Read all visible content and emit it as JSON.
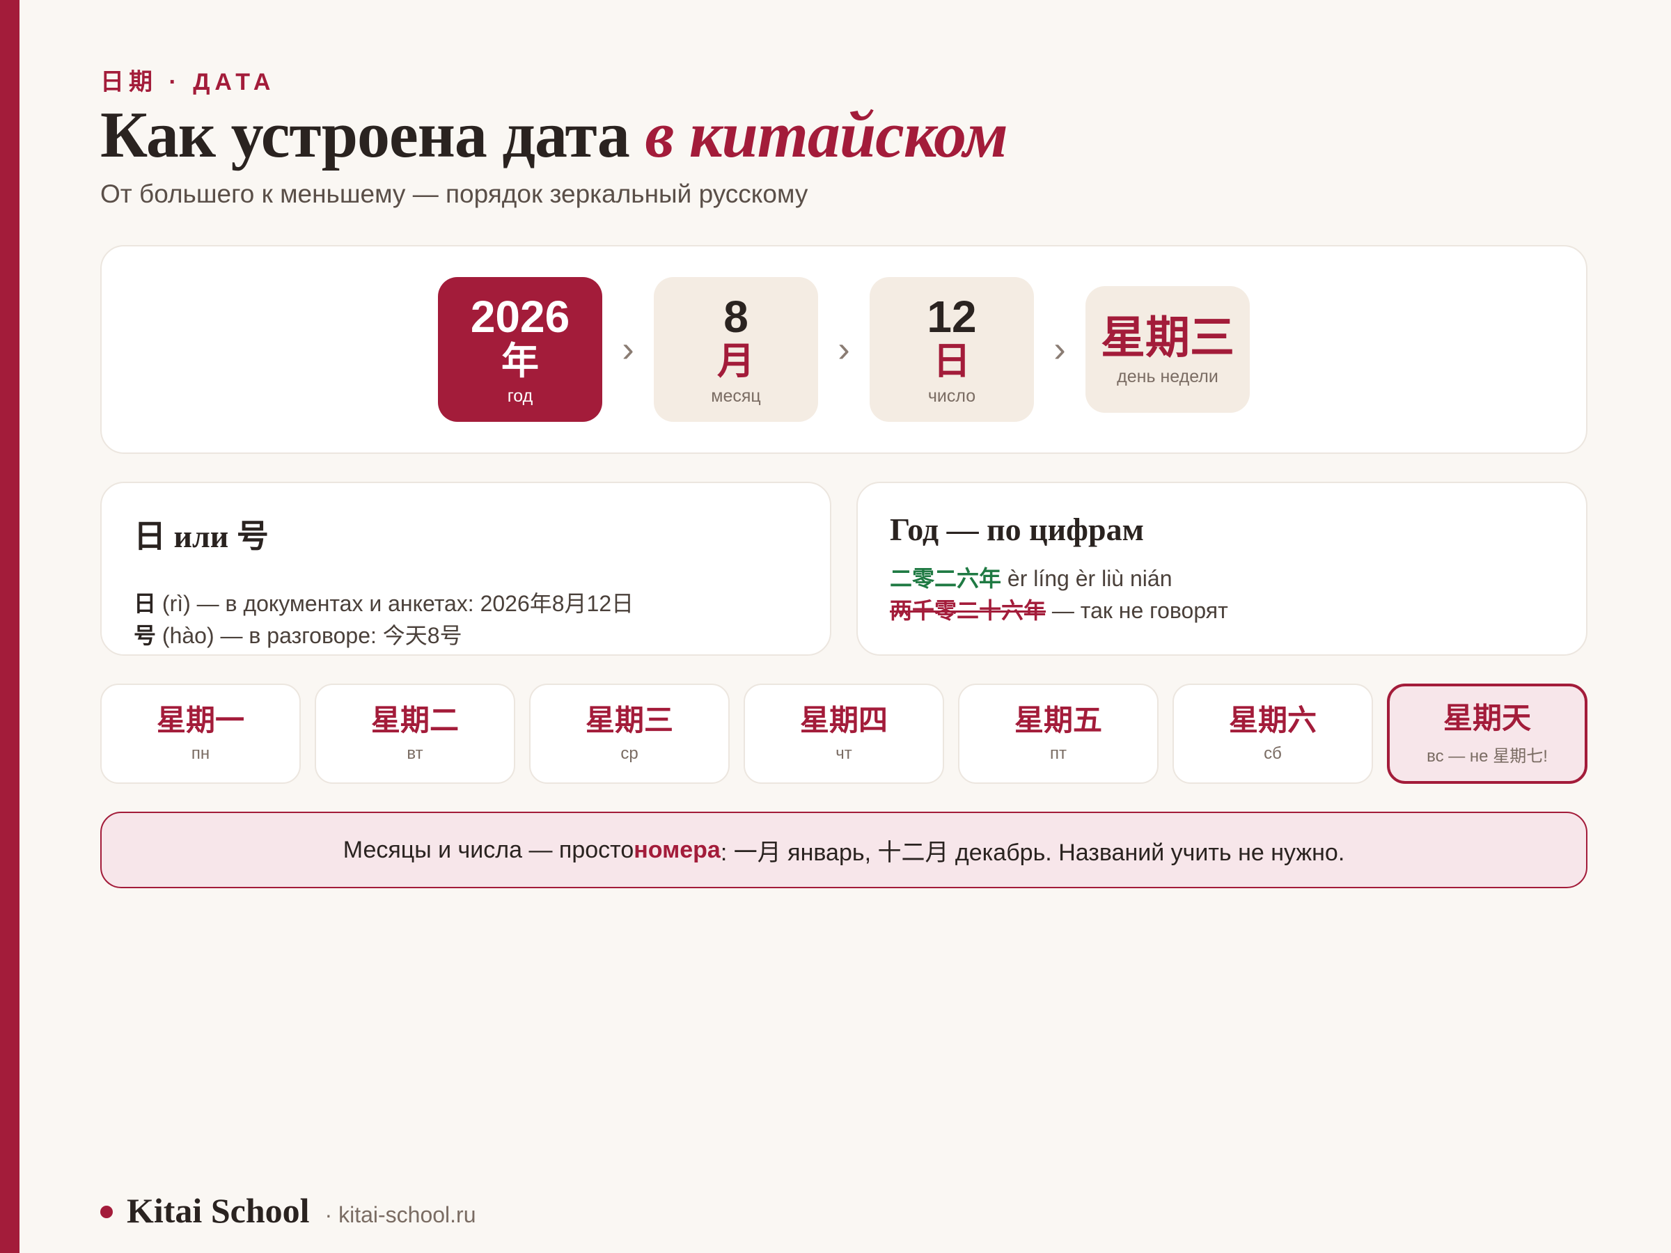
{
  "header": {
    "eyebrow": "日期 · ДАТА",
    "title_main": "Как устроена дата ",
    "title_accent": "в китайском",
    "subtitle": "От большего к меньшему — порядок зеркальный русскому"
  },
  "date_parts": [
    {
      "value": "2026",
      "hanzi": "年",
      "caption": "год"
    },
    {
      "value": "8",
      "hanzi": "月",
      "caption": "месяц"
    },
    {
      "value": "12",
      "hanzi": "日",
      "caption": "число"
    },
    {
      "hanzi": "星期三",
      "caption": "день недели"
    }
  ],
  "arrow_glyph": "›",
  "ri_hao": {
    "title": "日 или 号",
    "line1_char": "日",
    "line1_text": " (rì) — в документах и анкетах: 2026年8月12日",
    "line2_char": "号",
    "line2_text": " (hào) — в разговоре: 今天8号"
  },
  "year_digits": {
    "title": "Год — по цифрам",
    "correct_hanzi": "二零二六年",
    "correct_pinyin": " èr líng èr liù nián",
    "wrong_hanzi": "两千零二十六年",
    "wrong_note": " — так не говорят"
  },
  "weekdays": [
    {
      "hanzi": "星期一",
      "caption": "пн"
    },
    {
      "hanzi": "星期二",
      "caption": "вт"
    },
    {
      "hanzi": "星期三",
      "caption": "ср"
    },
    {
      "hanzi": "星期四",
      "caption": "чт"
    },
    {
      "hanzi": "星期五",
      "caption": "пт"
    },
    {
      "hanzi": "星期六",
      "caption": "сб"
    },
    {
      "hanzi": "星期天",
      "caption": "вс — не 星期七!"
    }
  ],
  "note": {
    "before": "Месяцы и числа — просто ",
    "highlight": "номера",
    "after": ": 一月 январь, 十二月 декабрь. Названий учить не нужно."
  },
  "footer": {
    "brand": "Kitai School",
    "url": "· kitai-school.ru"
  },
  "colors": {
    "accent": "#a31c3a",
    "background": "#faf7f3",
    "correct_green": "#1f7a43"
  }
}
